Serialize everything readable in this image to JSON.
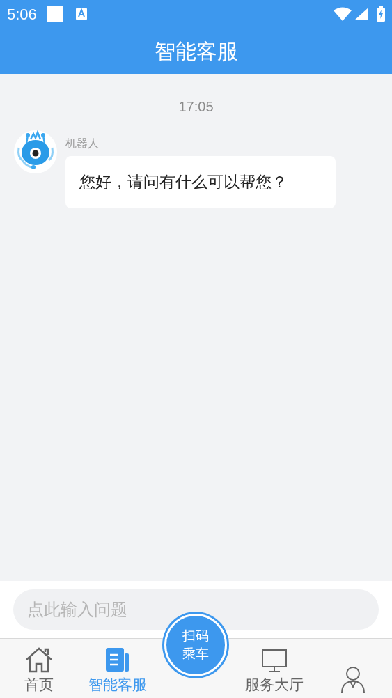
{
  "status_bar": {
    "time": "5:06"
  },
  "header": {
    "title": "智能客服"
  },
  "chat": {
    "timestamp": "17:05",
    "messages": [
      {
        "sender": "机器人",
        "text": "您好，请问有什么可以帮您？"
      }
    ]
  },
  "input": {
    "placeholder": "点此输入问题"
  },
  "nav": [
    {
      "kind": "tab",
      "label": "首页",
      "selected": false
    },
    {
      "kind": "tab",
      "label": "智能客服",
      "selected": true
    },
    {
      "kind": "scan",
      "lines": [
        "扫码",
        "乘车"
      ]
    },
    {
      "kind": "tab",
      "label": "服务大厅",
      "selected": false
    },
    {
      "kind": "tab",
      "selected": false
    }
  ]
}
